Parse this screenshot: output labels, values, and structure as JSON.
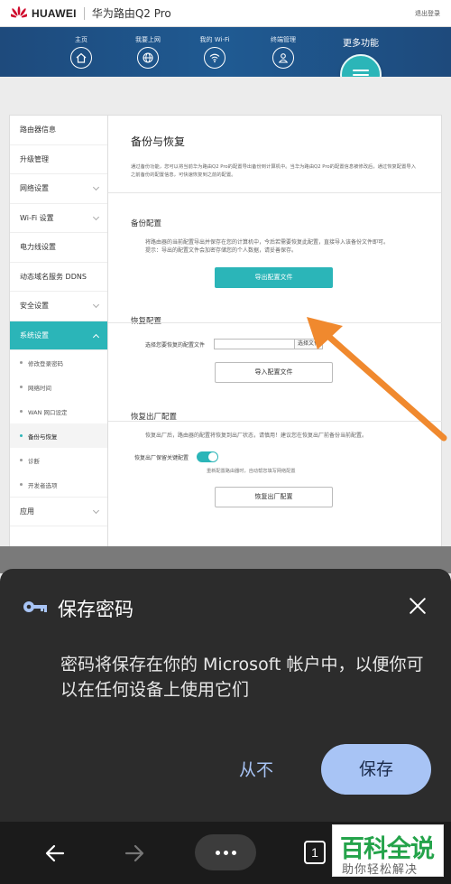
{
  "header": {
    "brand": "HUAWEI",
    "product": "华为路由Q2 Pro",
    "logout": "退出登录"
  },
  "nav": {
    "items": [
      {
        "label": "主页",
        "icon": "home-icon"
      },
      {
        "label": "我要上网",
        "icon": "globe-icon"
      },
      {
        "label": "我的 Wi-Fi",
        "icon": "wifi-icon"
      },
      {
        "label": "终端管理",
        "icon": "user-icon"
      }
    ],
    "more": "更多功能"
  },
  "sidebar": {
    "items": [
      {
        "label": "路由器信息"
      },
      {
        "label": "升级管理"
      },
      {
        "label": "网络设置"
      },
      {
        "label": "Wi-Fi 设置"
      },
      {
        "label": "电力线设置"
      },
      {
        "label": "动态域名服务 DDNS"
      },
      {
        "label": "安全设置"
      },
      {
        "label": "系统设置"
      },
      {
        "label": "应用"
      }
    ],
    "sub": [
      {
        "label": "修改登录密码"
      },
      {
        "label": "网络时间"
      },
      {
        "label": "WAN 网口设定"
      },
      {
        "label": "备份与恢复"
      },
      {
        "label": "诊断"
      },
      {
        "label": "开发者选项"
      }
    ]
  },
  "main": {
    "title": "备份与恢复",
    "desc": "通过备份功能，您可以将当前华为路由Q2 Pro的配置导出备份到计算机中。当华为路由Q2 Pro的配置信息被修改后，通过恢复配置导入之前备份的配置信息，可快速恢复到之前的配置。",
    "backup": {
      "title": "备份配置",
      "desc": "将路由器的当前配置导出并保存在您的计算机中，今后若需要恢复此配置，直接导入该备份文件即可。",
      "note": "提示：导出的配置文件会加密存储您的个人数据，请妥善保存。",
      "button": "导出配置文件"
    },
    "restore": {
      "title": "恢复配置",
      "file_label": "选择您要恢复的配置文件",
      "file_button": "选择文件",
      "button": "导入配置文件"
    },
    "factory": {
      "title": "恢复出厂配置",
      "desc": "恢复出厂后，路由器的配置将恢复到出厂状态，请慎用！建议您在恢复出厂前备份当前配置。",
      "toggle_label": "恢复出厂保留关键配置",
      "hint": "重新配置路由器时，自动帮您填写网络配置",
      "button": "恢复出厂配置"
    }
  },
  "sheet": {
    "title": "保存密码",
    "body": "密码将保存在你的 Microsoft 帐户中，以便你可以在任何设备上使用它们",
    "never": "从不",
    "save": "保存"
  },
  "toolbar": {
    "tabs_count": "1"
  },
  "watermark": {
    "main": "百科全说",
    "sub": "助你轻松解决"
  },
  "colors": {
    "accent": "#2bb5b8",
    "nav_bg": "#1f5a92",
    "sheet_bg": "#2c2c2c",
    "save_btn": "#a8c4f5",
    "arrow": "#f0892e"
  }
}
